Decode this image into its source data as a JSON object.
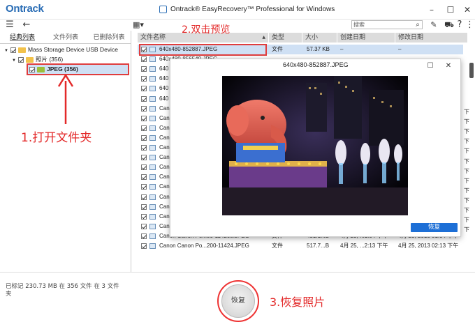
{
  "app": {
    "logo": "Ontrack",
    "title": "Ontrack® EasyRecovery™ Professional for Windows"
  },
  "search": {
    "placeholder": "搜索"
  },
  "left_tabs": [
    "经典列表",
    "文件列表",
    "已删除列表"
  ],
  "tree": [
    {
      "label": "Mass Storage Device USB Device"
    },
    {
      "label": "照片 (356)"
    },
    {
      "label": "JPEG (356)"
    }
  ],
  "columns": [
    "文件名称",
    "类型",
    "大小",
    "创建日期",
    "修改日期"
  ],
  "rows": [
    {
      "name": "640x480-852887.JPEG",
      "type": "文件",
      "size": "57.37 KB",
      "created": "–",
      "modified": "–"
    },
    {
      "name": "640x480-856549.JPEG"
    },
    {
      "name": "640"
    },
    {
      "name": "640"
    },
    {
      "name": "640"
    },
    {
      "name": "640"
    },
    {
      "name": "Can"
    },
    {
      "name": "Can"
    },
    {
      "name": "Can"
    },
    {
      "name": "Can"
    },
    {
      "name": "Can"
    },
    {
      "name": "Can"
    },
    {
      "name": "Can"
    },
    {
      "name": "Can"
    },
    {
      "name": "Can"
    },
    {
      "name": "Can"
    },
    {
      "name": "Can"
    },
    {
      "name": "Canon Canon Po...00-112000.JPEG"
    },
    {
      "name": "Canon Canon Po...00-113120.JPEG",
      "type": "文件",
      "size": "542.1...B",
      "created": "4月 25, ...1:04 下午",
      "modified": "4月 25, 2013 01:04 下午"
    },
    {
      "name": "Canon Canon Po...00-114208.JPEG",
      "type": "文件",
      "size": "451.1...B",
      "created": "4月 25, ...1:04 下午",
      "modified": "4月 25, 2013 01:04 下午"
    },
    {
      "name": "Canon Canon Po...200-11424.JPEG",
      "type": "文件",
      "size": "517.7...B",
      "created": "4月 25, ...2:13 下午",
      "modified": "4月 25, 2013 02:13 下午"
    }
  ],
  "right_edge": [
    "下",
    "下",
    "下",
    "下",
    "下",
    "下",
    "下",
    "下",
    "下",
    "下",
    "下",
    "下",
    "下"
  ],
  "preview": {
    "title": "640x480-852887.JPEG",
    "restore_label": "恢复"
  },
  "status_text": "已标记 230.73 MB 在 356 文件 在 3 文件夹",
  "restore_button": "恢复",
  "annotations": {
    "step1": "1.打开文件夹",
    "step2": "2.双击预览",
    "step3": "3.恢复照片"
  },
  "colors": {
    "accent": "#1d6fd6",
    "annotation": "#e32929",
    "logo": "#2a6db5"
  }
}
